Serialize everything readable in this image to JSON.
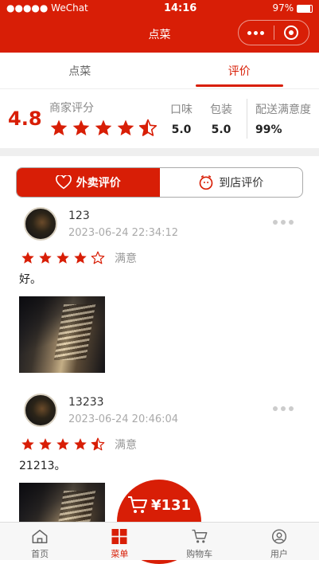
{
  "status_bar": {
    "carrier": "●●●●● WeChat",
    "time": "14:16",
    "battery": "97%"
  },
  "nav": {
    "title": "点菜"
  },
  "tabs": [
    {
      "label": "点菜",
      "active": false
    },
    {
      "label": "评价",
      "active": true
    }
  ],
  "scores": {
    "overall": "4.8",
    "merchant_label": "商家评分",
    "merchant_stars": 4.5,
    "taste_label": "口味",
    "taste_value": "5.0",
    "packaging_label": "包装",
    "packaging_value": "5.0",
    "delivery_label": "配送满意度",
    "delivery_value": "99%"
  },
  "segment": {
    "takeaway": "外卖评价",
    "instore": "到店评价"
  },
  "reviews": [
    {
      "name": "123",
      "date": "2023-06-24 22:34:12",
      "stars": 4,
      "rating_text": "满意",
      "content": "好。"
    },
    {
      "name": "13233",
      "date": "2023-06-24 20:46:04",
      "stars": 4.5,
      "rating_text": "满意",
      "content": "21213。"
    }
  ],
  "cart": {
    "price": "¥131"
  },
  "bottom_nav": [
    {
      "label": "首页",
      "icon": "home-icon"
    },
    {
      "label": "菜单",
      "icon": "menu-grid-icon"
    },
    {
      "label": "购物车",
      "icon": "cart-icon"
    },
    {
      "label": "用户",
      "icon": "user-icon"
    }
  ],
  "colors": {
    "accent": "#d81e06",
    "muted": "#999999"
  }
}
